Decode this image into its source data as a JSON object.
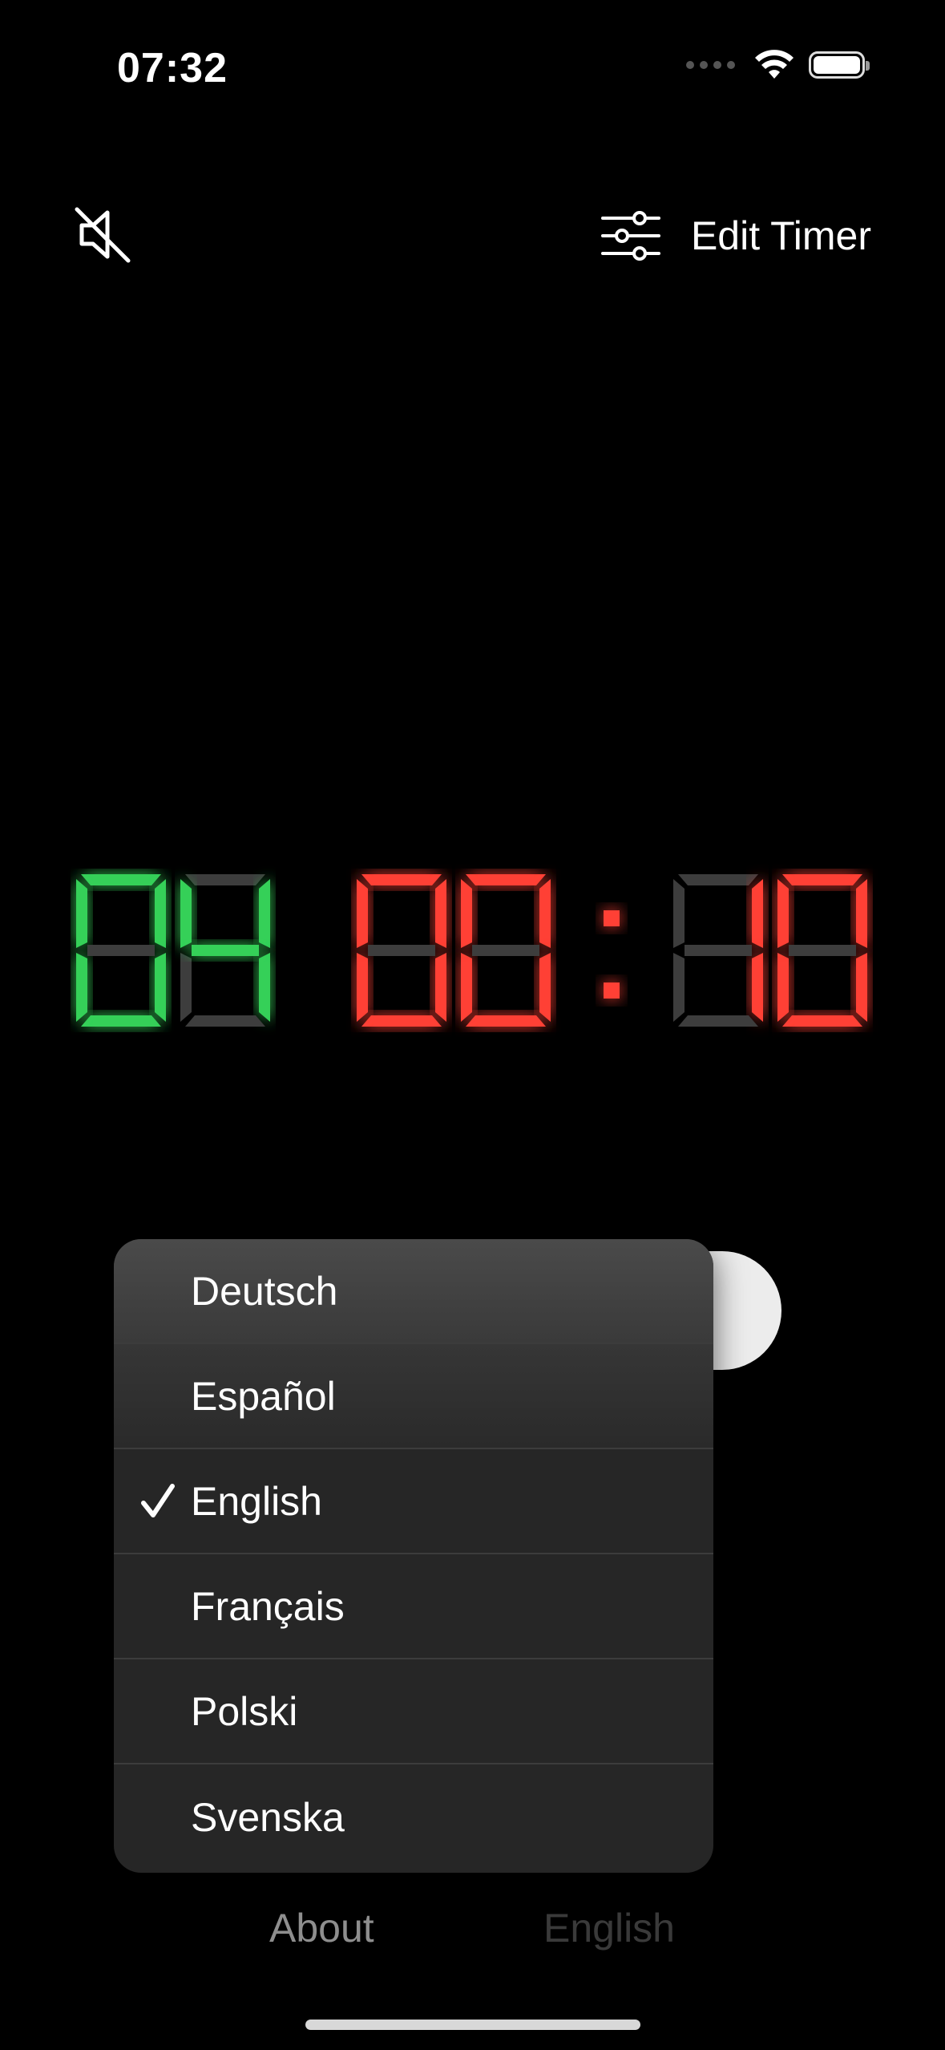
{
  "status_bar": {
    "time": "07:32"
  },
  "toolbar": {
    "edit_timer_label": "Edit Timer"
  },
  "timer": {
    "rounds": "04",
    "minutes": "00",
    "seconds": "10",
    "colors": {
      "rounds": "#34d058",
      "time": "#ff4136",
      "inactive": "#3d3d3d"
    }
  },
  "language_menu": {
    "items": [
      {
        "label": "Deutsch",
        "selected": false
      },
      {
        "label": "Español",
        "selected": false
      },
      {
        "label": "English",
        "selected": true
      },
      {
        "label": "Français",
        "selected": false
      },
      {
        "label": "Polski",
        "selected": false
      },
      {
        "label": "Svenska",
        "selected": false
      }
    ]
  },
  "bottom": {
    "about_label": "About",
    "language_label": "English"
  }
}
